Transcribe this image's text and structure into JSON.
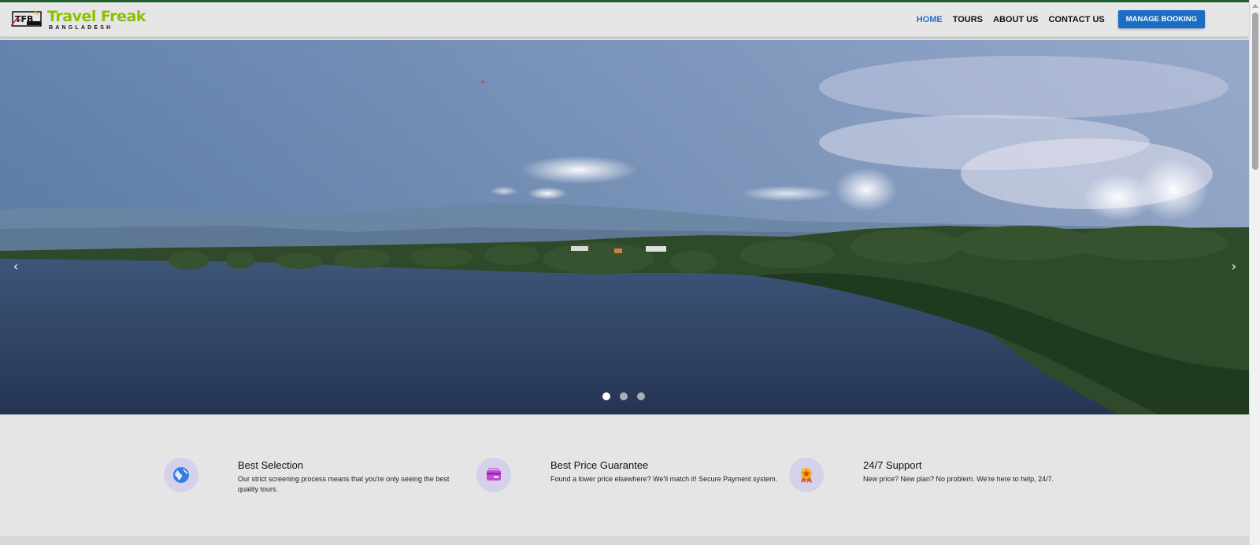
{
  "brand": {
    "title": "Travel Freak",
    "subtitle": "BANGLADESH",
    "badge": "TFB"
  },
  "nav": {
    "items": [
      {
        "label": "HOME",
        "active": true
      },
      {
        "label": "TOURS",
        "active": false
      },
      {
        "label": "ABOUT US",
        "active": false
      },
      {
        "label": "CONTACT US",
        "active": false
      }
    ],
    "manage_booking": "MANAGE BOOKING"
  },
  "hero": {
    "prev_icon": "chevron-left-icon",
    "next_icon": "chevron-right-icon",
    "slides": 3,
    "active_slide": 1
  },
  "features": [
    {
      "icon": "globe-icon",
      "title": "Best Selection",
      "desc": "Our strict screening process means that you're only seeing the best quality tours."
    },
    {
      "icon": "credit-card-icon",
      "title": "Best Price Guarantee",
      "desc": "Found a lower price elsewhere? We'll match it! Secure Payment system."
    },
    {
      "icon": "award-medal-icon",
      "title": "24/7 Support",
      "desc": "New price? New plan? No problem. We're here to help, 24/7."
    }
  ],
  "colors": {
    "accent": "#1a6cc4",
    "nav_active": "#2a6fd0",
    "logo_green": "#8cc000",
    "topline": "#1f5e2b"
  }
}
